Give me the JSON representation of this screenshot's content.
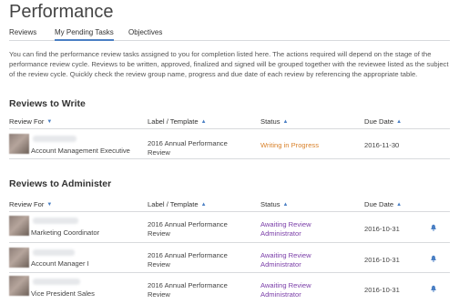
{
  "page": {
    "title": "Performance"
  },
  "tabs": [
    {
      "label": "Reviews"
    },
    {
      "label": "My Pending Tasks"
    },
    {
      "label": "Objectives"
    }
  ],
  "intro": "You can find the performance review tasks assigned to you for completion listed here. The actions required will depend on the stage of the performance review cycle. Reviews to be written, approved, finalized and signed will be grouped together with the reviewee listed as the subject of the review cycle. Quickly check the review group name, progress and due date of each review by referencing the appropriate table.",
  "write": {
    "title": "Reviews to Write",
    "columns": [
      "Review For",
      "Label / Template",
      "Status",
      "Due Date"
    ],
    "rows": [
      {
        "role": "Account Management Executive",
        "template": "2016 Annual Performance Review",
        "status": "Writing in Progress",
        "due": "2016-11-30"
      }
    ]
  },
  "administer": {
    "title": "Reviews to Administer",
    "columns": [
      "Review For",
      "Label / Template",
      "Status",
      "Due Date"
    ],
    "rows": [
      {
        "role": "Marketing Coordinator",
        "template": "2016 Annual Performance Review",
        "status": "Awaiting Review Administrator",
        "due": "2016-10-31",
        "icon": "bell-icon"
      },
      {
        "role": "Account Manager I",
        "template": "2016 Annual Performance Review",
        "status": "Awaiting Review Administrator",
        "due": "2016-10-31",
        "icon": "bell-icon"
      },
      {
        "role": "Vice President Sales",
        "template": "2016 Annual Performance Review",
        "status": "Awaiting Review Administrator",
        "due": "2016-10-31",
        "icon": "bell-icon"
      }
    ]
  },
  "colors": {
    "accent": "#4a7fc4",
    "progress": "#d9822b",
    "awaiting": "#7a3da8"
  }
}
